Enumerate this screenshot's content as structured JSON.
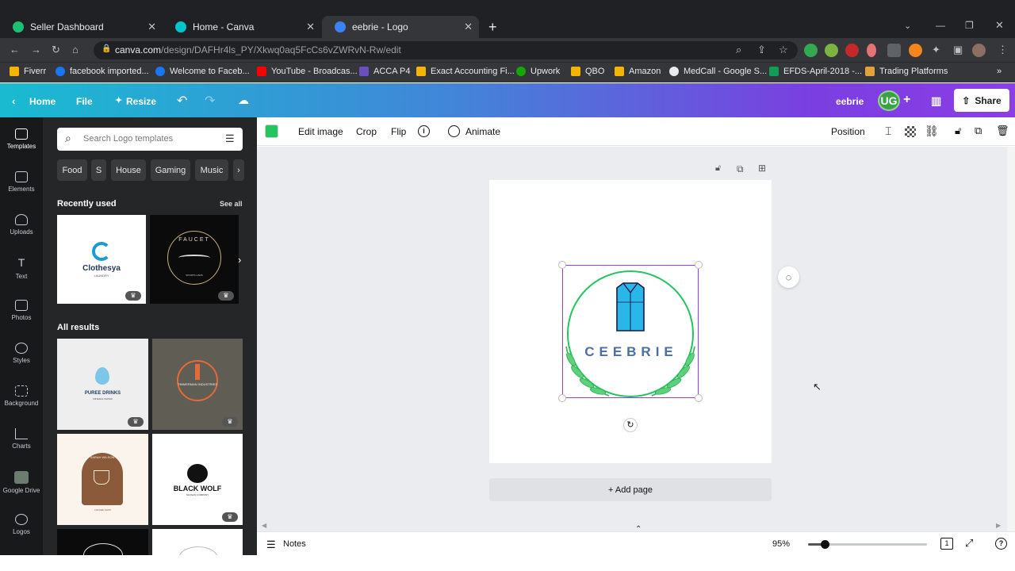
{
  "browser": {
    "tabs": [
      {
        "title": "Seller Dashboard",
        "icon": "fiverr-favicon"
      },
      {
        "title": "Home - Canva",
        "icon": "canva-favicon"
      },
      {
        "title": "eebrie - Logo",
        "icon": "canva-favicon"
      }
    ],
    "new_tab": "+",
    "url_host": "canva.com",
    "url_path": "/design/DAFHr4ls_PY/Xkwq0aq5FcCs6vZWRvN-Rw/edit",
    "bookmarks": [
      "Fiverr",
      "facebook imported...",
      "Welcome to Faceb...",
      "YouTube - Broadcas...",
      "ACCA P4",
      "Exact Accounting Fi...",
      "Upwork",
      "QBO",
      "Amazon",
      "MedCall - Google S...",
      "EFDS-April-2018 -...",
      "Trading Platforms"
    ]
  },
  "header": {
    "home": "Home",
    "file": "File",
    "resize": "Resize",
    "design_name": "eebrie",
    "avatar": "UG",
    "share": "Share"
  },
  "rail": [
    "Templates",
    "Elements",
    "Uploads",
    "Text",
    "Photos",
    "Styles",
    "Background",
    "Charts",
    "Google Drive",
    "Logos"
  ],
  "panel": {
    "search_placeholder": "Search Logo templates",
    "chips": [
      "Food",
      "S",
      "House",
      "Gaming",
      "Music"
    ],
    "recently_used": "Recently used",
    "see_all": "See all",
    "all_results": "All results",
    "templates": {
      "clothesya": "Clothesya",
      "clothesya_sub": "LAUNDRY",
      "faucet": "FAUCET",
      "faucet_sub": "SPORTS CARS",
      "puree": "PUREE DRINKS",
      "puree_sub": "MINERAL WATER",
      "timmerman": "TIMMERMAN INDUSTRIES",
      "sarah": "SARAH WILSON",
      "sarah_sub": "COFFEE SHOP",
      "wolf": "BLACK WOLF",
      "wolf_sub": "SLOGAN COMPANY"
    }
  },
  "toolbar": {
    "color": "#22c55e",
    "edit_image": "Edit image",
    "crop": "Crop",
    "flip": "Flip",
    "animate": "Animate",
    "position": "Position"
  },
  "canvas": {
    "logo_text": "CEEBRIE",
    "add_page": "+ Add page"
  },
  "footer": {
    "notes": "Notes",
    "zoom": "95%",
    "zoom_level": 0.14,
    "page_count": "1"
  },
  "colors": {
    "accent_green": "#22c55e",
    "logo_blue": "#4a6fa5",
    "shirt": "#29b6e8",
    "selection": "#8b3dff"
  }
}
